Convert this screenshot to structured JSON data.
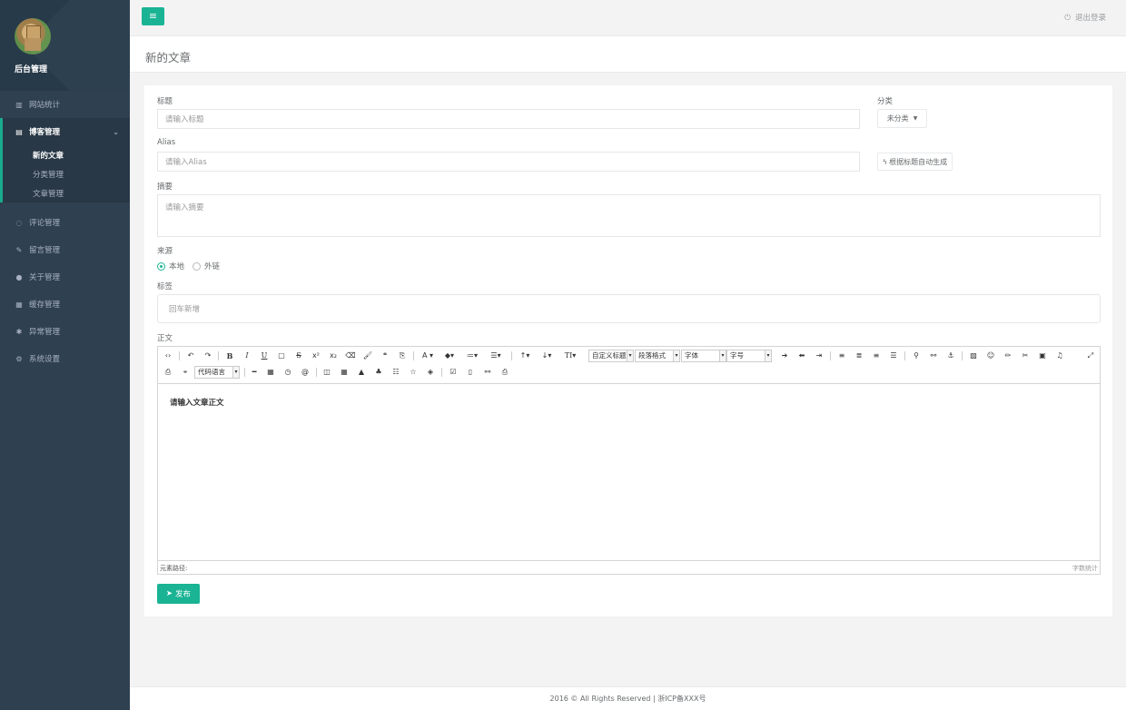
{
  "sidebar": {
    "brand": "后台管理",
    "items": [
      {
        "label": "网站统计",
        "icon": "bar-chart-icon"
      },
      {
        "label": "博客管理",
        "icon": "file-icon",
        "expanded": true,
        "children": [
          "新的文章",
          "分类管理",
          "文章管理"
        ],
        "active_child": "新的文章"
      },
      {
        "label": "评论管理",
        "icon": "comments-icon"
      },
      {
        "label": "留言管理",
        "icon": "edit-icon"
      },
      {
        "label": "关于管理",
        "icon": "user-icon"
      },
      {
        "label": "缓存管理",
        "icon": "database-icon"
      },
      {
        "label": "异常管理",
        "icon": "bug-icon"
      },
      {
        "label": "系统设置",
        "icon": "cogs-icon"
      }
    ]
  },
  "topbar": {
    "logout": "退出登录"
  },
  "page": {
    "title": "新的文章"
  },
  "form": {
    "title_label": "标题",
    "title_placeholder": "请输入标题",
    "category_label": "分类",
    "category_value": "未分类",
    "alias_label": "Alias",
    "alias_placeholder": "请输入Alias",
    "alias_button": "根据标题自动生成",
    "summary_label": "摘要",
    "summary_placeholder": "请输入摘要",
    "source_label": "来源",
    "source_options": [
      "本地",
      "外链"
    ],
    "source_selected": "本地",
    "tags_label": "标签",
    "tags_placeholder": "回车新增",
    "body_label": "正文",
    "editor": {
      "placeholder": "请输入文章正文",
      "selects": [
        "自定义标题",
        "段落格式",
        "字体",
        "字号",
        "代码语言"
      ],
      "path_label": "元素路径:",
      "word_count_label": "字数统计"
    },
    "publish_button": "发布"
  },
  "footer": {
    "text": "2016 © All Rights Reserved | 浙ICP备XXX号"
  },
  "colors": {
    "accent": "#1ab394",
    "sidebar": "#2f4050"
  }
}
